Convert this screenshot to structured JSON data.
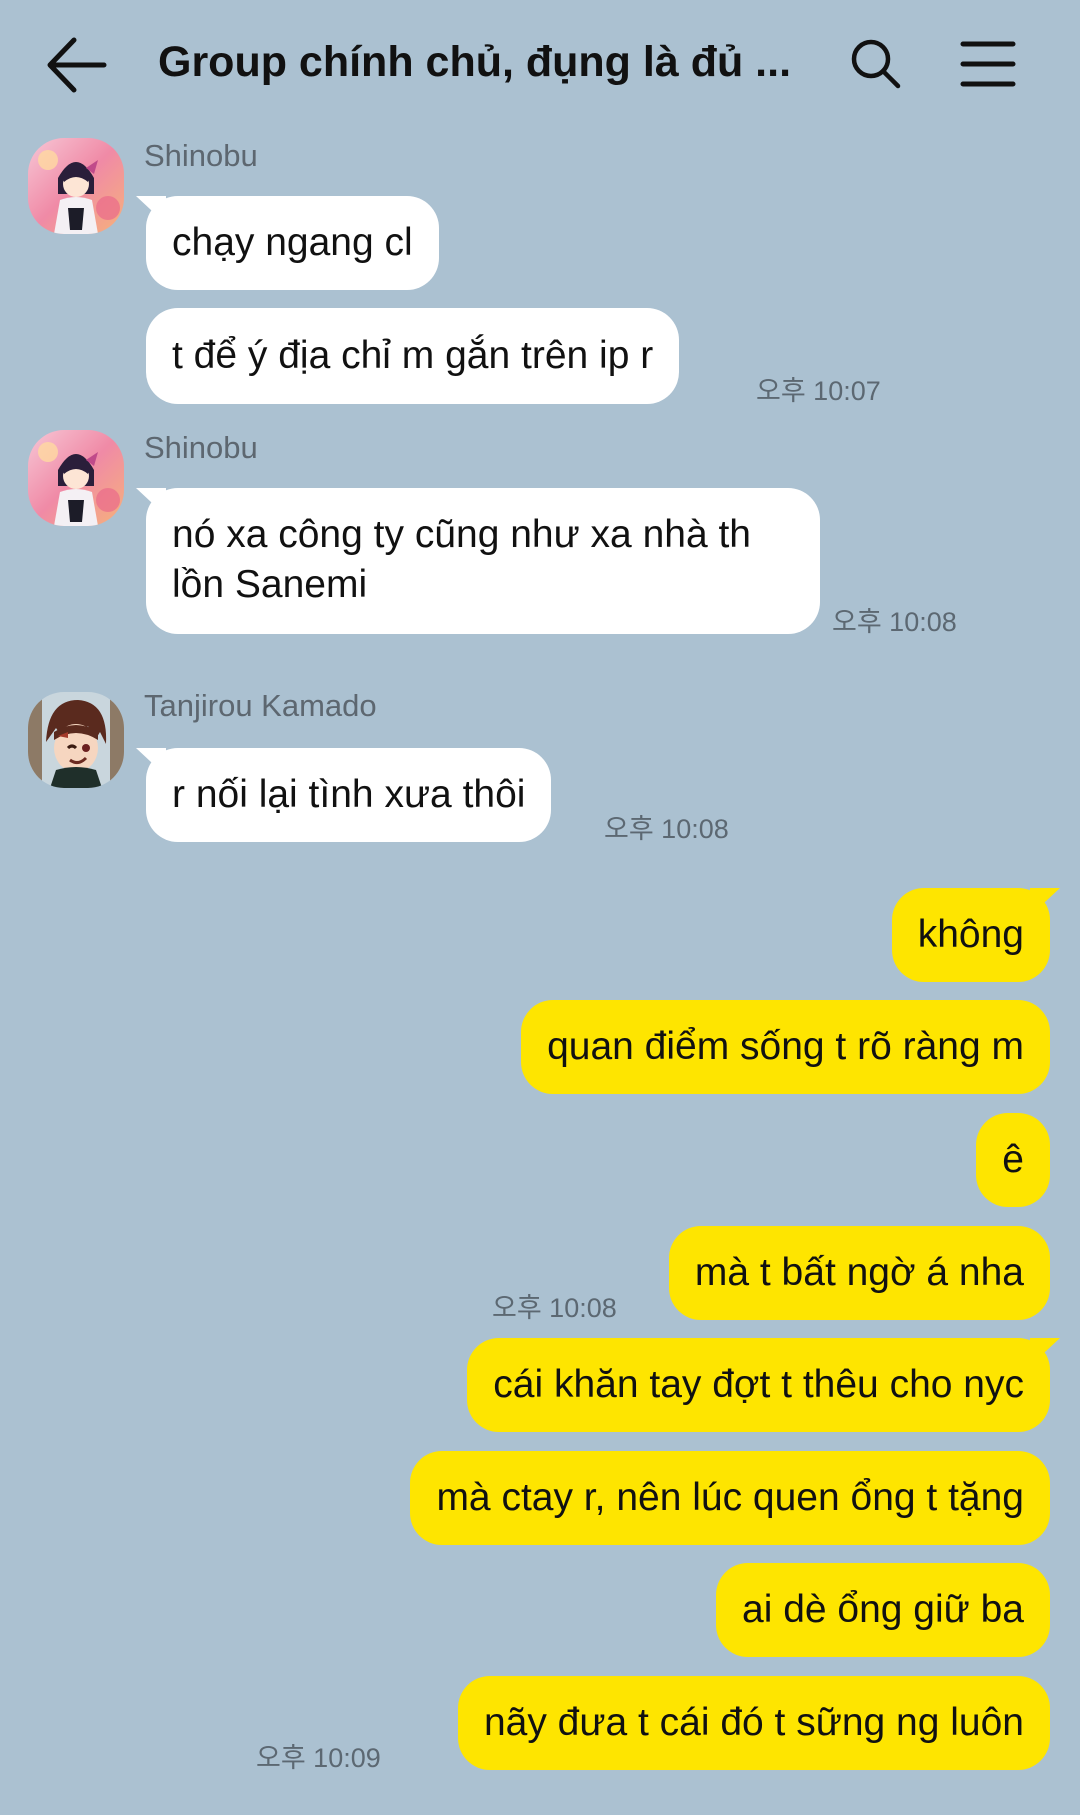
{
  "header": {
    "title": "Group chính chủ, đụng là đủ ...",
    "back_icon": "arrow-left-icon",
    "search_icon": "search-icon",
    "menu_icon": "hamburger-menu-icon"
  },
  "messages": {
    "g1": {
      "sender": "Shinobu",
      "m1": "chạy ngang cl",
      "m2": "t để ý địa chỉ m gắn trên ip r",
      "time": "오후 10:07"
    },
    "g2": {
      "sender": "Shinobu",
      "m1": "nó xa công ty cũng như xa nhà th lồn Sanemi",
      "time": "오후 10:08"
    },
    "g3": {
      "sender": "Tanjirou Kamado",
      "m1": "r nối lại tình xưa thôi",
      "time": "오후 10:08"
    },
    "out1": {
      "m1": "không",
      "m2": "quan điểm sống t rõ ràng m",
      "m3": "ê",
      "m4": "mà t bất ngờ á nha",
      "time": "오후 10:08"
    },
    "out2": {
      "m1": "cái khăn tay đợt t thêu cho nyc",
      "m2": "mà ctay r, nên lúc quen ổng t tặng",
      "m3": "ai dè ổng giữ ba",
      "m4": "nãy đưa t cái đó t sững ng luôn",
      "time": "오후 10:09"
    }
  },
  "colors": {
    "background": "#abc1d1",
    "incoming_bubble": "#ffffff",
    "outgoing_bubble": "#fee500"
  }
}
